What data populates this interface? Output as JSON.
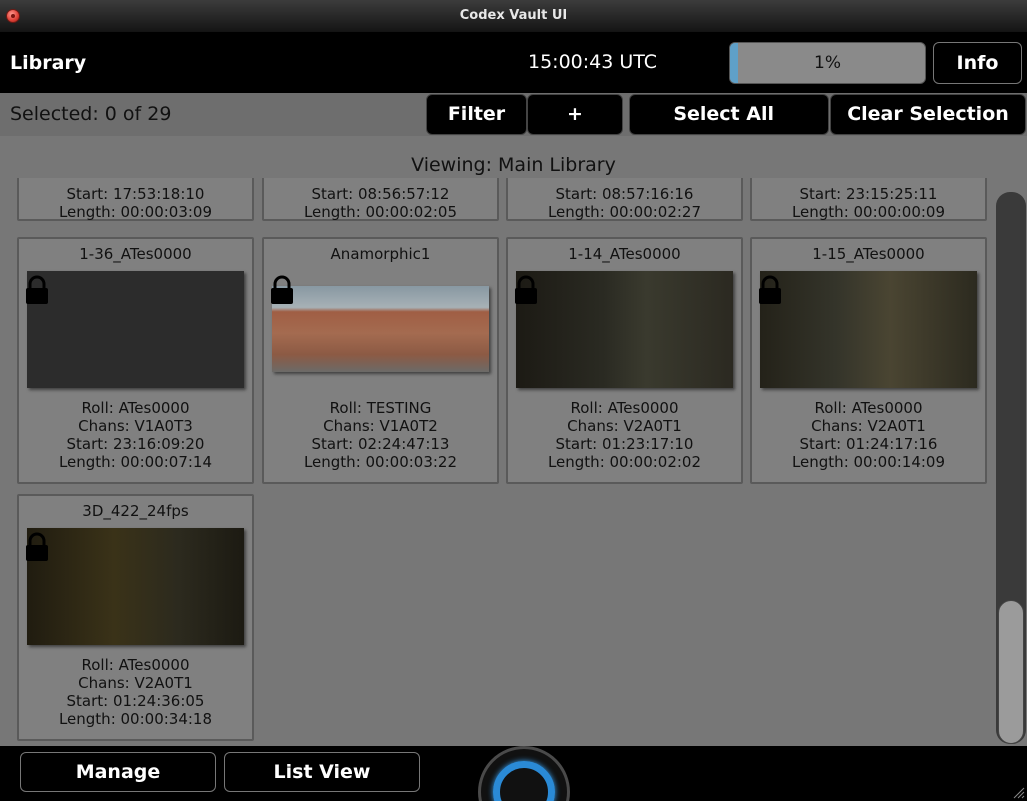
{
  "window": {
    "title": "Codex Vault UI"
  },
  "header": {
    "section": "Library",
    "clock": "15:00:43 UTC",
    "progress": {
      "label": "1%",
      "fraction": 0.01
    },
    "info_label": "Info"
  },
  "toolbar": {
    "selected": "Selected: 0 of 29",
    "filter_label": "Filter",
    "add_label": "+",
    "select_all_label": "Select All",
    "clear_selection_label": "Clear Selection"
  },
  "viewing": "Viewing: Main Library",
  "partial_row": [
    {
      "start": "Start: 17:53:18:10",
      "length": "Length: 00:00:03:09"
    },
    {
      "start": "Start: 08:56:57:12",
      "length": "Length: 00:00:02:05"
    },
    {
      "start": "Start: 08:57:16:16",
      "length": "Length: 00:00:02:27"
    },
    {
      "start": "Start: 23:15:25:11",
      "length": "Length: 00:00:00:09"
    }
  ],
  "clips": [
    {
      "name": "1-36_ATes0000",
      "roll": "Roll: ATes0000",
      "chans": "Chans: V1A0T3",
      "start": "Start: 23:16:09:20",
      "length": "Length: 00:00:07:14",
      "locked": true
    },
    {
      "name": "Anamorphic1",
      "roll": "Roll: TESTING",
      "chans": "Chans: V1A0T2",
      "start": "Start: 02:24:47:13",
      "length": "Length: 00:00:03:22",
      "locked": true
    },
    {
      "name": "1-14_ATes0000",
      "roll": "Roll: ATes0000",
      "chans": "Chans: V2A0T1",
      "start": "Start: 01:23:17:10",
      "length": "Length: 00:00:02:02",
      "locked": true
    },
    {
      "name": "1-15_ATes0000",
      "roll": "Roll: ATes0000",
      "chans": "Chans: V2A0T1",
      "start": "Start: 01:24:17:16",
      "length": "Length: 00:00:14:09",
      "locked": true
    },
    {
      "name": "3D_422_24fps",
      "roll": "Roll: ATes0000",
      "chans": "Chans: V2A0T1",
      "start": "Start: 01:24:36:05",
      "length": "Length: 00:00:34:18",
      "locked": true
    }
  ],
  "footer": {
    "manage_label": "Manage",
    "list_view_label": "List View"
  },
  "icons": [
    "close-icon",
    "lock-icon",
    "resize-grip-icon"
  ],
  "colors": {
    "progress_fill": "#5fa0c8",
    "accent_ring": "#2a8ad6"
  }
}
